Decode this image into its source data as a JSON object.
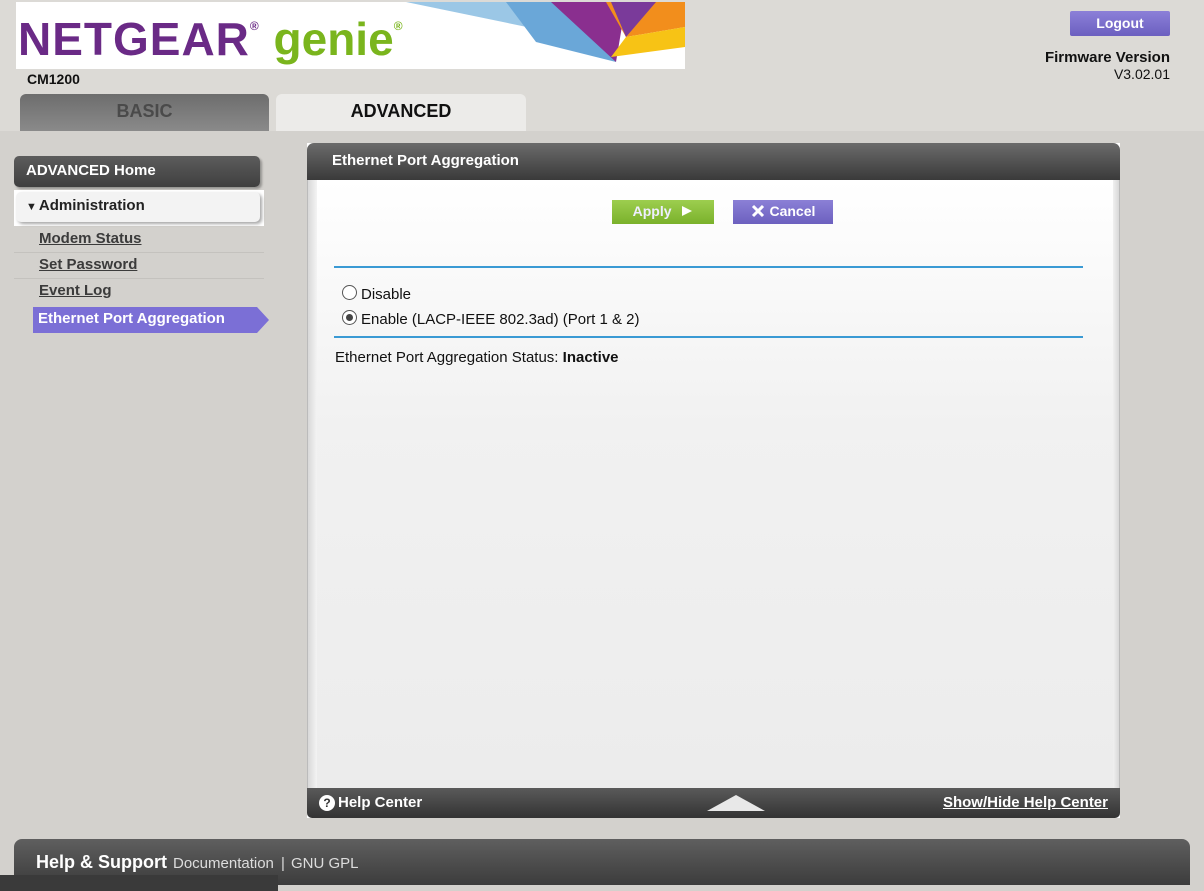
{
  "header": {
    "brand_main": "NETGEAR",
    "brand_genie": "genie",
    "reg_mark": "®",
    "model": "CM1200",
    "logout_label": "Logout",
    "firmware_title": "Firmware Version",
    "firmware_version": "V3.02.01"
  },
  "tabs": {
    "basic": "BASIC",
    "advanced": "ADVANCED"
  },
  "sidebar": {
    "home": "ADVANCED Home",
    "section_arrow": "▼",
    "section_title": "Administration",
    "items": [
      {
        "label": "Modem Status"
      },
      {
        "label": "Set Password"
      },
      {
        "label": "Event Log"
      },
      {
        "label": "Ethernet Port Aggregation"
      }
    ]
  },
  "panel": {
    "title": "Ethernet Port Aggregation",
    "apply_label": "Apply",
    "cancel_label": "Cancel",
    "options": [
      {
        "label": "Disable",
        "checked": false
      },
      {
        "label": "Enable (LACP-IEEE 802.3ad) (Port 1 & 2)",
        "checked": true
      }
    ],
    "status_label": "Ethernet Port Aggregation Status:",
    "status_value": "Inactive",
    "help_center": "Help Center",
    "show_hide": "Show/Hide Help Center"
  },
  "footer": {
    "title": "Help & Support",
    "documentation": "Documentation",
    "separator": "|",
    "gpl": "GNU GPL"
  },
  "colors": {
    "accent_purple": "#6b5fc0",
    "apply_green": "#7ab12b",
    "rule_blue": "#3a9ad4",
    "brand_purple": "#6a2a86",
    "brand_green": "#7ab51d"
  },
  "icons": {
    "help": "question-circle-icon",
    "toggle": "triangle-up-icon",
    "apply_arrow": "play-arrow-icon",
    "cancel_x": "close-icon"
  }
}
